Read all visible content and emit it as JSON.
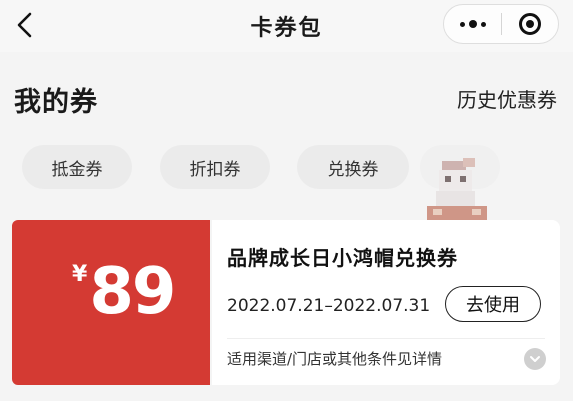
{
  "nav": {
    "title": "卡券包",
    "back_icon": "chevron-left-icon",
    "more_icon": "more-dots-icon",
    "close_icon": "target-close-icon"
  },
  "section": {
    "title": "我的券",
    "history_link": "历史优惠券"
  },
  "tabs": [
    {
      "label": "抵金券"
    },
    {
      "label": "折扣券"
    },
    {
      "label": "兑换券"
    }
  ],
  "coupon": {
    "currency": "¥",
    "value": "89",
    "name": "品牌成长日小鸿帽兑换券",
    "dates": "2022.07.21–2022.07.31",
    "use_button": "去使用",
    "terms": "适用渠道/门店或其他条件见详情",
    "expand_icon": "chevron-down-icon"
  },
  "colors": {
    "coupon_red": "#d43a33",
    "background": "#f4f4f4"
  }
}
